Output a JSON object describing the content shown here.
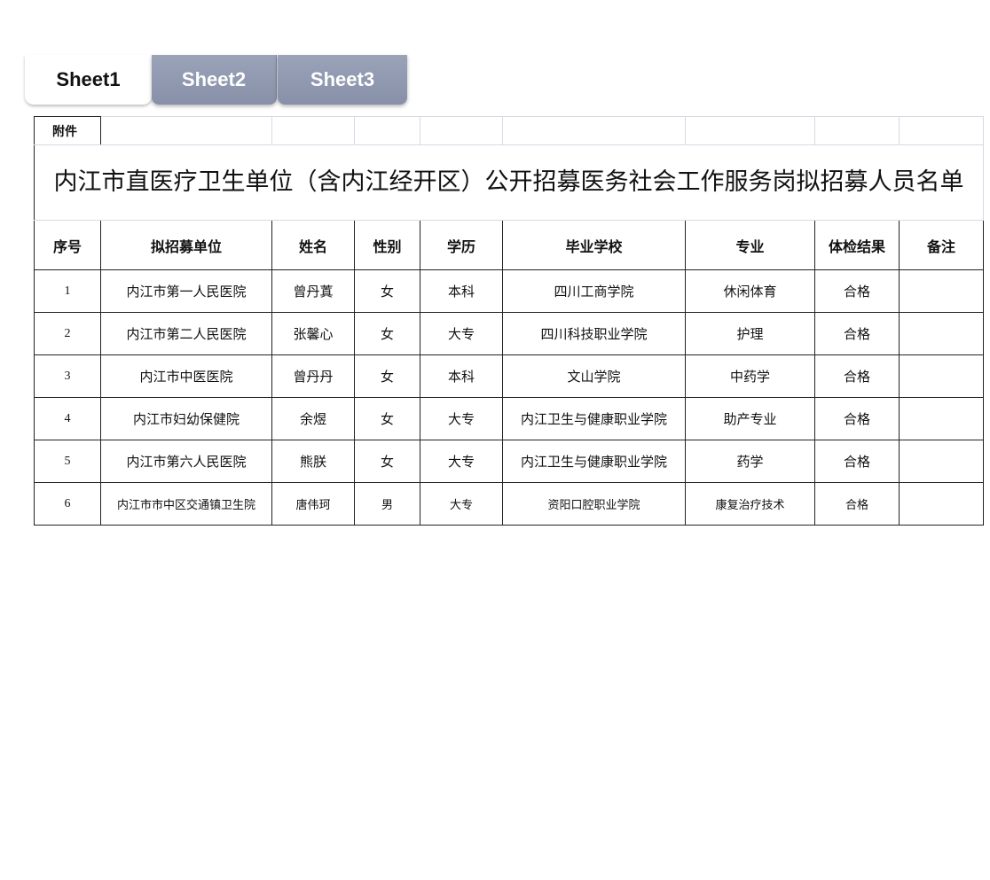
{
  "tabs": [
    {
      "label": "Sheet1",
      "active": true
    },
    {
      "label": "Sheet2",
      "active": false
    },
    {
      "label": "Sheet3",
      "active": false
    }
  ],
  "sheet": {
    "attachment_label": "附件",
    "title": "内江市直医疗卫生单位（含内江经开区）公开招募医务社会工作服务岗拟招募人员名单",
    "headers": [
      "序号",
      "拟招募单位",
      "姓名",
      "性别",
      "学历",
      "毕业学校",
      "专业",
      "体检结果",
      "备注"
    ],
    "rows": [
      [
        "1",
        "内江市第一人民医院",
        "曾丹蒖",
        "女",
        "本科",
        "四川工商学院",
        "休闲体育",
        "合格",
        ""
      ],
      [
        "2",
        "内江市第二人民医院",
        "张馨心",
        "女",
        "大专",
        "四川科技职业学院",
        "护理",
        "合格",
        ""
      ],
      [
        "3",
        "内江市中医医院",
        "曾丹丹",
        "女",
        "本科",
        "文山学院",
        "中药学",
        "合格",
        ""
      ],
      [
        "4",
        "内江市妇幼保健院",
        "余煜",
        "女",
        "大专",
        "内江卫生与健康职业学院",
        "助产专业",
        "合格",
        ""
      ],
      [
        "5",
        "内江市第六人民医院",
        "熊朕",
        "女",
        "大专",
        "内江卫生与健康职业学院",
        "药学",
        "合格",
        ""
      ],
      [
        "6",
        "内江市市中区交通镇卫生院",
        "唐伟珂",
        "男",
        "大专",
        "资阳口腔职业学院",
        "康复治疗技术",
        "合格",
        ""
      ]
    ]
  }
}
